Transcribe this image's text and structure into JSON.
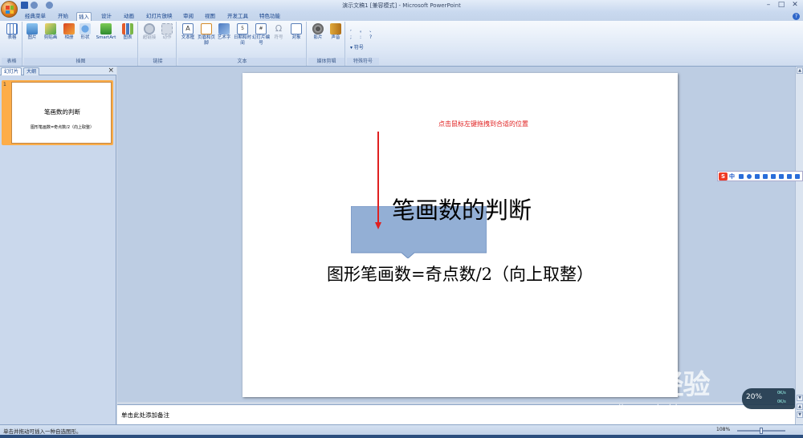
{
  "window": {
    "title": "演示文稿1 [兼容模式] - Microsoft PowerPoint",
    "controls": {
      "minimize": "–",
      "maximize": "□",
      "close": "✕"
    }
  },
  "ribbon_tabs": [
    "经典菜单",
    "开始",
    "插入",
    "设计",
    "动画",
    "幻灯片放映",
    "审阅",
    "视图",
    "开发工具",
    "特色功能"
  ],
  "active_tab": "插入",
  "help_label": "?",
  "groups": [
    {
      "label": "表格",
      "buttons": [
        "表格"
      ]
    },
    {
      "label": "插图",
      "buttons": [
        "图片",
        "剪贴画",
        "相册",
        "形状",
        "SmartArt",
        "图表"
      ]
    },
    {
      "label": "链接",
      "buttons": [
        "超链接",
        "动作"
      ]
    },
    {
      "label": "文本",
      "buttons": [
        "文本框",
        "页眉和页脚",
        "艺术字",
        "日期和时间",
        "幻灯片编号",
        "符号",
        "对象"
      ]
    },
    {
      "label": "媒体剪辑",
      "buttons": [
        "影片",
        "声音"
      ]
    },
    {
      "label": "特殊符号",
      "buttons": [
        "符号"
      ]
    }
  ],
  "special_symbols": [
    ",",
    "。",
    ";",
    ":",
    "?",
    "、"
  ],
  "left_panel": {
    "tabs": [
      "幻灯片",
      "大纲"
    ],
    "close": "×",
    "thumbnail": {
      "number": "1",
      "title": "笔画数的判断",
      "subtitle": "图形笔画数=奇点数/2（向上取整）"
    }
  },
  "slide": {
    "annotation": "点击鼠标左键拖拽到合适的位置",
    "title": "笔画数的判断",
    "subtitle": "图形笔画数=奇点数/2（向上取整）"
  },
  "notes_placeholder": "单击此处添加备注",
  "status": {
    "text": "单击并拖动可插入一种自选图形。",
    "zoom": "108%"
  },
  "ime": {
    "logo": "S",
    "mode": "中"
  },
  "watermark": {
    "brand": "Bai经验",
    "url": "jingyan.baidu.com"
  },
  "net_meter": {
    "percent": "20%",
    "up": "0K/s",
    "down": "0K/s"
  },
  "colors": {
    "accent": "#15428b",
    "annotation": "#e02020",
    "callout": "#93afd5",
    "thumb_selected": "#fdad49"
  }
}
